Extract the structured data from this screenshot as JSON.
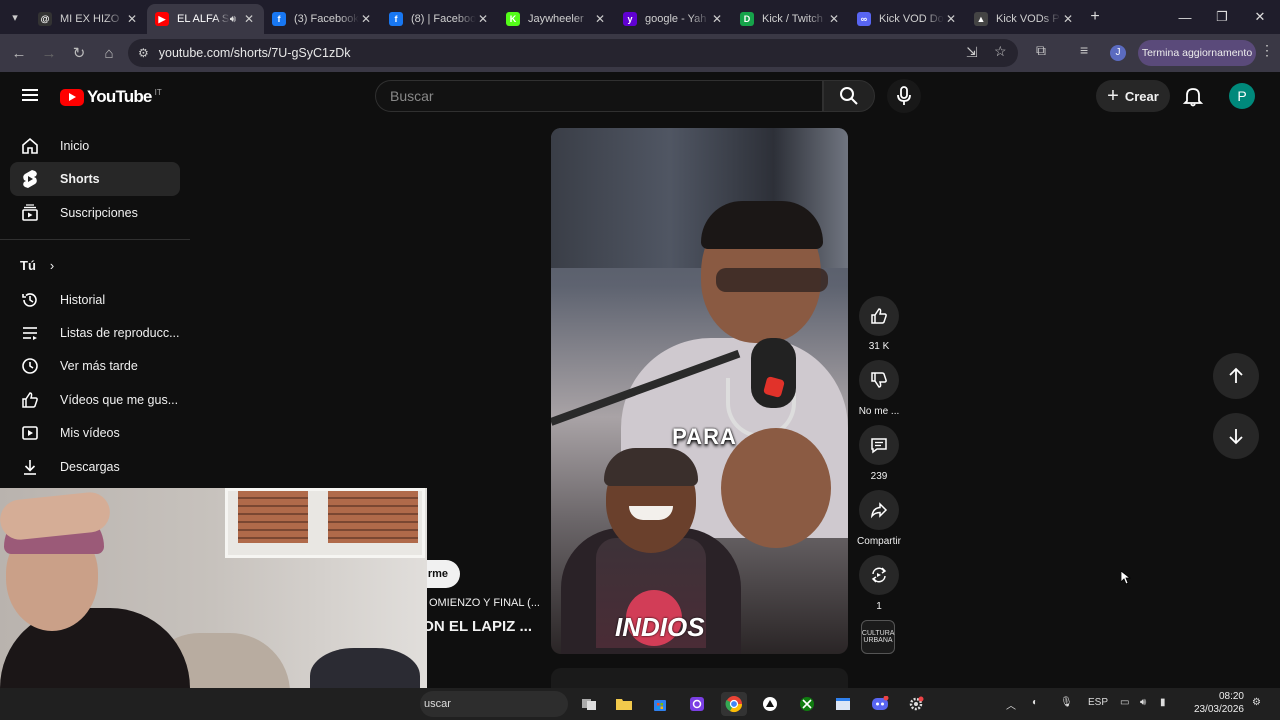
{
  "browser": {
    "tabs": [
      {
        "title": "MI EX HIZO",
        "favicon": "threads-icon",
        "color": "#333333",
        "glyph": "@"
      },
      {
        "title": "EL ALFA S",
        "favicon": "youtube-icon",
        "color": "#ff0000",
        "glyph": "▶",
        "active": true,
        "audio": true
      },
      {
        "title": "(3) Facebook",
        "favicon": "facebook-icon",
        "color": "#1877f2",
        "glyph": "f"
      },
      {
        "title": "(8) | Facebook",
        "favicon": "facebook-icon",
        "color": "#1877f2",
        "glyph": "f"
      },
      {
        "title": "Jaywheeler",
        "favicon": "kick-icon",
        "color": "#53fc18",
        "glyph": "K"
      },
      {
        "title": "google - Yah",
        "favicon": "yahoo-icon",
        "color": "#6001d2",
        "glyph": "y"
      },
      {
        "title": "Kick / Twitch",
        "favicon": "d-icon",
        "color": "#16a34a",
        "glyph": "D"
      },
      {
        "title": "Kick VOD Do",
        "favicon": "vod-icon",
        "color": "#5865f2",
        "glyph": "∞"
      },
      {
        "title": "Kick VODs P",
        "favicon": "vods-icon",
        "color": "#444444",
        "glyph": "▲"
      }
    ],
    "url": "youtube.com/shorts/7U-gSyC1zDk",
    "update_label": "Termina aggiornamento",
    "profile_initial": "J"
  },
  "youtube": {
    "logo_text": "YouTube",
    "country": "IT",
    "search_placeholder": "Buscar",
    "create_label": "Crear",
    "avatar_initial": "P",
    "sidebar": {
      "main": [
        {
          "label": "Inicio",
          "icon": "home-icon"
        },
        {
          "label": "Shorts",
          "icon": "shorts-icon",
          "active": true
        },
        {
          "label": "Suscripciones",
          "icon": "subscriptions-icon"
        }
      ],
      "you_heading": "Tú",
      "you": [
        {
          "label": "Historial",
          "icon": "history-icon"
        },
        {
          "label": "Listas de reproducc...",
          "icon": "playlists-icon"
        },
        {
          "label": "Ver más tarde",
          "icon": "watch-later-icon"
        },
        {
          "label": "Vídeos que me gus...",
          "icon": "liked-icon"
        },
        {
          "label": "Mis vídeos",
          "icon": "my-videos-icon"
        },
        {
          "label": "Descargas",
          "icon": "downloads-icon"
        }
      ]
    },
    "short": {
      "caption": "PARA",
      "jersey_text": "INDIOS",
      "follow_label": "rme",
      "song_text": "OMIENZO Y FINAL (...",
      "title_text": "ON EL LAPIZ ...",
      "channel_badge": "CULTURA URBANA"
    },
    "actions": {
      "likes": "31 K",
      "dislike_label": "No me ...",
      "comments": "239",
      "share_label": "Compartir",
      "remix_count": "1"
    }
  },
  "taskbar": {
    "search_text": "uscar",
    "language": "ESP",
    "time": "08:20",
    "date": "23/03/2026"
  }
}
